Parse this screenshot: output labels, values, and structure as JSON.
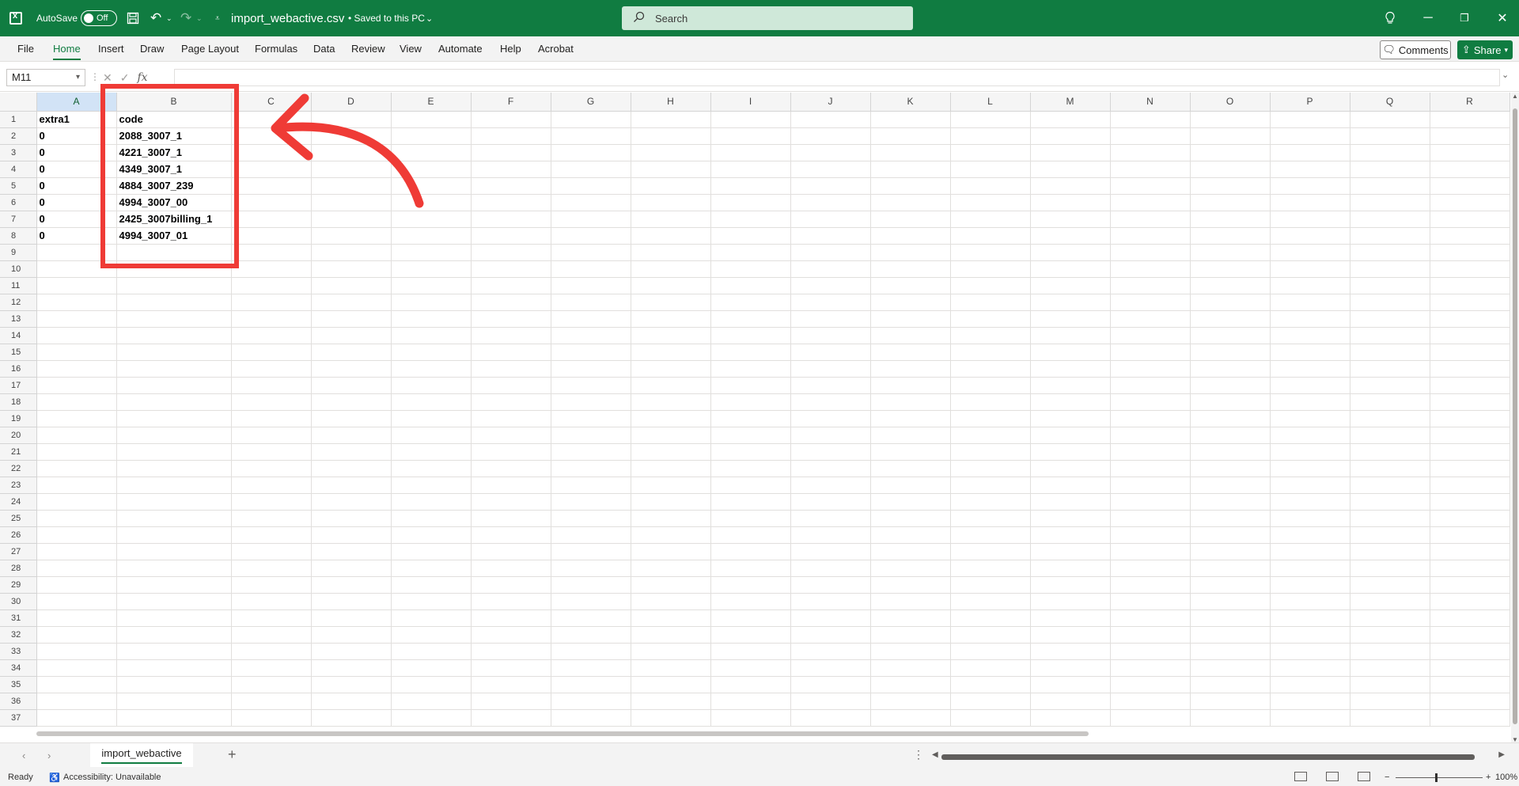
{
  "titlebar": {
    "autosave_label": "AutoSave",
    "autosave_state": "Off",
    "doc_title": "import_webactive.csv",
    "saved_status": "• Saved to this PC",
    "search_placeholder": "Search"
  },
  "ribbon": {
    "tabs": [
      "File",
      "Home",
      "Insert",
      "Draw",
      "Page Layout",
      "Formulas",
      "Data",
      "Review",
      "View",
      "Automate",
      "Help",
      "Acrobat"
    ],
    "active_tab": "Home",
    "comments_label": "Comments",
    "share_label": "Share"
  },
  "formula_bar": {
    "name_box": "M11",
    "fx_label": "fx",
    "formula_value": ""
  },
  "grid": {
    "columns": [
      "A",
      "B",
      "C",
      "D",
      "E",
      "F",
      "G",
      "H",
      "I",
      "J",
      "K",
      "L",
      "M",
      "N",
      "O",
      "P",
      "Q",
      "R"
    ],
    "selected_column": "A",
    "row_count": 37,
    "cells": [
      [
        "extra1",
        "code"
      ],
      [
        "0",
        "2088_3007_1"
      ],
      [
        "0",
        "4221_3007_1"
      ],
      [
        "0",
        "4349_3007_1"
      ],
      [
        "0",
        "4884_3007_239"
      ],
      [
        "0",
        "4994_3007_00"
      ],
      [
        "0",
        "2425_3007billing_1"
      ],
      [
        "0",
        "4994_3007_01"
      ]
    ]
  },
  "sheets": {
    "tabs": [
      "import_webactive"
    ],
    "active": "import_webactive"
  },
  "statusbar": {
    "ready": "Ready",
    "accessibility": "Accessibility: Unavailable",
    "zoom": "100%"
  },
  "colors": {
    "brand": "#107c41",
    "annotation": "#ef3b36"
  }
}
